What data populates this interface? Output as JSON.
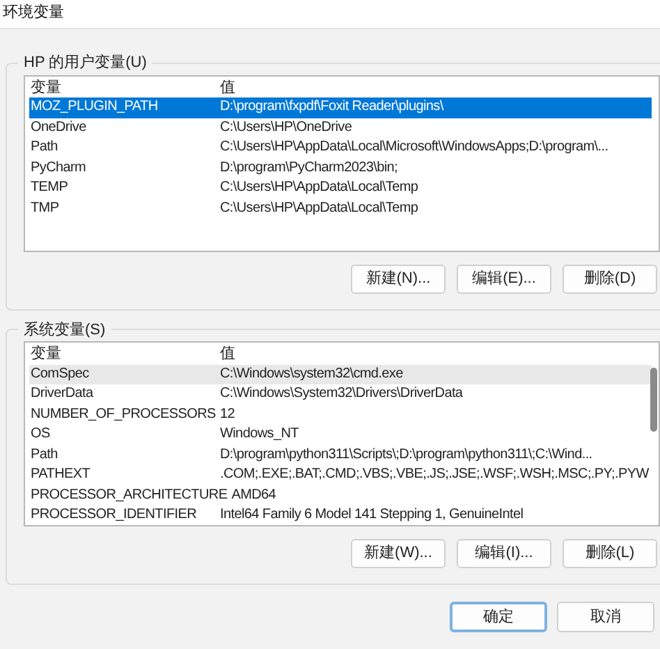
{
  "window": {
    "title": "环境变量"
  },
  "user_vars": {
    "label": "HP 的用户变量(U)",
    "columns": [
      "变量",
      "值"
    ],
    "rows": [
      {
        "name": "MOZ_PLUGIN_PATH",
        "value": "D:\\program\\fxpdf\\Foxit Reader\\plugins\\",
        "selected": true
      },
      {
        "name": "OneDrive",
        "value": "C:\\Users\\HP\\OneDrive",
        "selected": false
      },
      {
        "name": "Path",
        "value": "C:\\Users\\HP\\AppData\\Local\\Microsoft\\WindowsApps;D:\\program\\...",
        "selected": false
      },
      {
        "name": "PyCharm",
        "value": "D:\\program\\PyCharm2023\\bin;",
        "selected": false
      },
      {
        "name": "TEMP",
        "value": "C:\\Users\\HP\\AppData\\Local\\Temp",
        "selected": false
      },
      {
        "name": "TMP",
        "value": "C:\\Users\\HP\\AppData\\Local\\Temp",
        "selected": false
      }
    ],
    "buttons": [
      "新建(N)...",
      "编辑(E)...",
      "删除(D)"
    ]
  },
  "system_vars": {
    "label": "系统变量(S)",
    "columns": [
      "变量",
      "值"
    ],
    "rows": [
      {
        "name": "ComSpec",
        "value": "C:\\Windows\\system32\\cmd.exe",
        "selected": false,
        "hovered": true
      },
      {
        "name": "DriverData",
        "value": "C:\\Windows\\System32\\Drivers\\DriverData",
        "selected": false,
        "hovered": false
      },
      {
        "name": "NUMBER_OF_PROCESSORS",
        "value": "12",
        "selected": false,
        "hovered": false
      },
      {
        "name": "OS",
        "value": "Windows_NT",
        "selected": false,
        "hovered": false
      },
      {
        "name": "Path",
        "value": "D:\\program\\python311\\Scripts\\;D:\\program\\python311\\;C:\\Wind...",
        "selected": false,
        "hovered": false
      },
      {
        "name": "PATHEXT",
        "value": ".COM;.EXE;.BAT;.CMD;.VBS;.VBE;.JS;.JSE;.WSF;.WSH;.MSC;.PY;.PYW",
        "selected": false,
        "hovered": false
      },
      {
        "name": "PROCESSOR_ARCHITECTURE",
        "value": "AMD64",
        "selected": false,
        "hovered": false
      },
      {
        "name": "PROCESSOR_IDENTIFIER",
        "value": "Intel64 Family 6 Model 141 Stepping 1, GenuineIntel",
        "selected": false,
        "hovered": false
      }
    ],
    "buttons": [
      "新建(W)...",
      "编辑(I)...",
      "删除(L)"
    ]
  },
  "dialog_buttons": [
    {
      "label": "确定",
      "default": true
    },
    {
      "label": "取消",
      "default": false
    }
  ]
}
